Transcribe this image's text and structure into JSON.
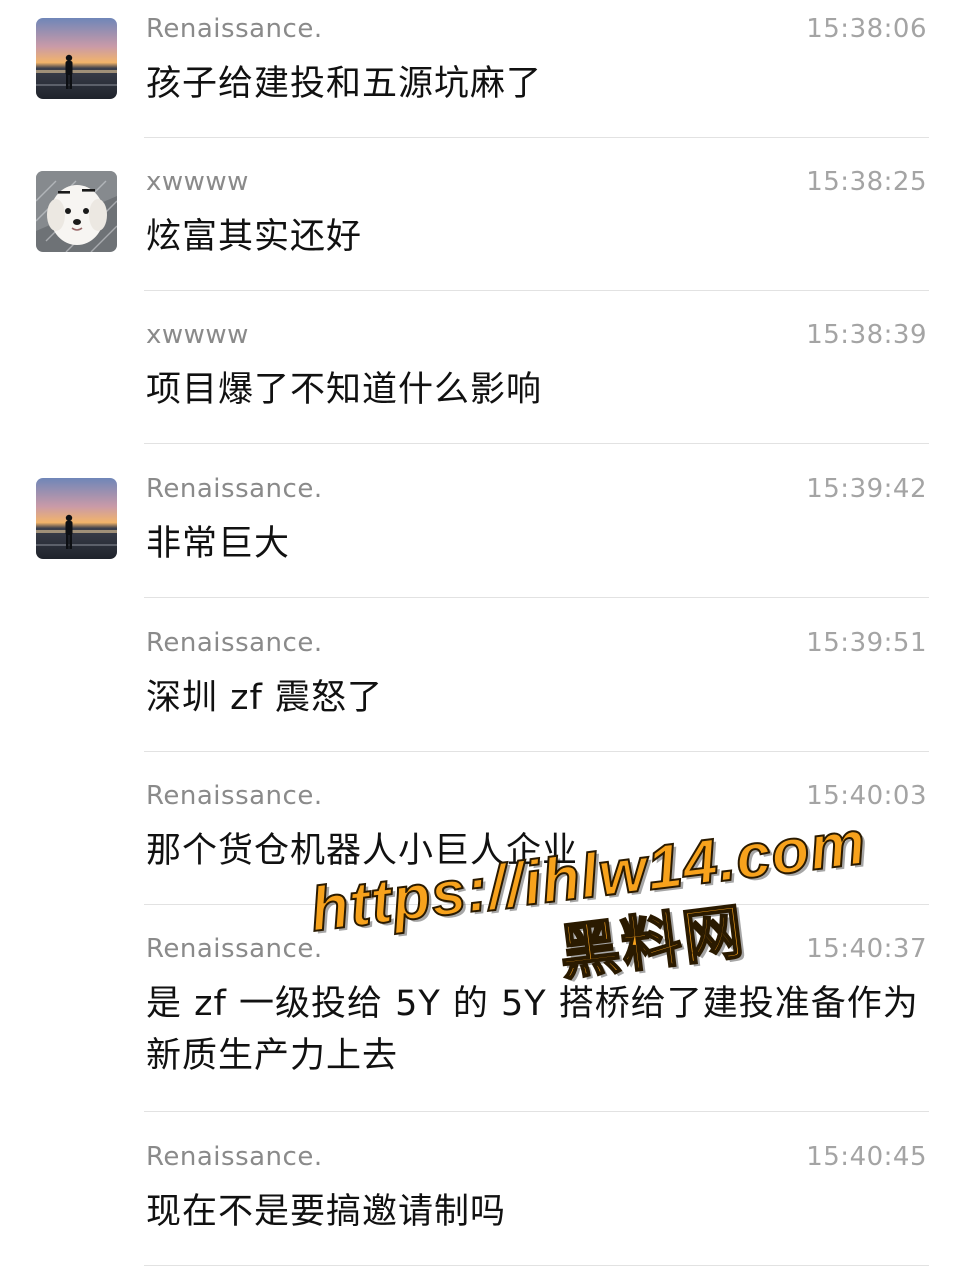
{
  "messages": [
    {
      "name": "Renaissance.",
      "time": "15:38:06",
      "text": "孩子给建投和五源坑麻了",
      "avatar": "sunset-person"
    },
    {
      "name": "xwwww",
      "time": "15:38:25",
      "text": "炫富其实还好",
      "avatar": "white-dog"
    },
    {
      "name": "xwwww",
      "time": "15:38:39",
      "text": "项目爆了不知道什么影响",
      "avatar": null
    },
    {
      "name": "Renaissance.",
      "time": "15:39:42",
      "text": "非常巨大",
      "avatar": "sunset-person"
    },
    {
      "name": "Renaissance.",
      "time": "15:39:51",
      "text": "深圳 zf 震怒了",
      "avatar": null
    },
    {
      "name": "Renaissance.",
      "time": "15:40:03",
      "text": "那个货仓机器人小巨人企业",
      "avatar": null
    },
    {
      "name": "Renaissance.",
      "time": "15:40:37",
      "text": "是 zf 一级投给 5Y 的 5Y 搭桥给了建投准备作为新质生产力上去",
      "avatar": null
    },
    {
      "name": "Renaissance.",
      "time": "15:40:45",
      "text": "现在不是要搞邀请制吗",
      "avatar": null
    }
  ],
  "watermark": {
    "url": "https://ihlw14.com",
    "site_name": "黑料网"
  },
  "colors": {
    "name": "#8a8a8a",
    "time": "#a4a4a4",
    "text": "#111111",
    "divider": "#e2e2e2",
    "watermark": "#f7a21c"
  }
}
